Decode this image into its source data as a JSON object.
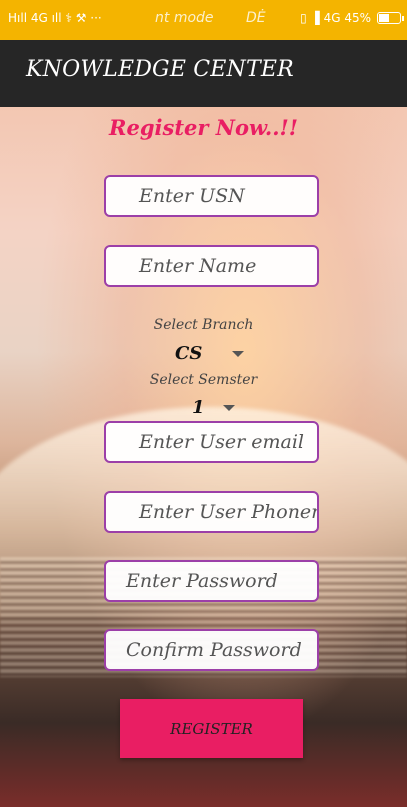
{
  "statusbar": {
    "left": "Hıll 4G ıll ⚕ ⚒ ···",
    "mid1": "nt mode",
    "mid2": "DĖ",
    "right": "▯ ▐ 4G 45%"
  },
  "appbar": {
    "title": "KNOWLEDGE CENTER"
  },
  "form": {
    "heading": "Register Now..!!",
    "usn_placeholder": "Enter USN",
    "name_placeholder": "Enter Name",
    "branch_label": "Select Branch",
    "branch_value": "CS",
    "semester_label": "Select Semster",
    "semester_value": "1",
    "email_placeholder": "Enter User email",
    "phone_placeholder": "Enter User Phoneno",
    "password_placeholder": "Enter Password",
    "confirm_placeholder": "Confirm Password",
    "register_label": "REGISTER"
  },
  "colors": {
    "statusbar": "#f4b400",
    "appbar": "#262626",
    "accent": "#e91e63",
    "field_border": "#9c3fa8"
  },
  "battery_level": 0.45
}
